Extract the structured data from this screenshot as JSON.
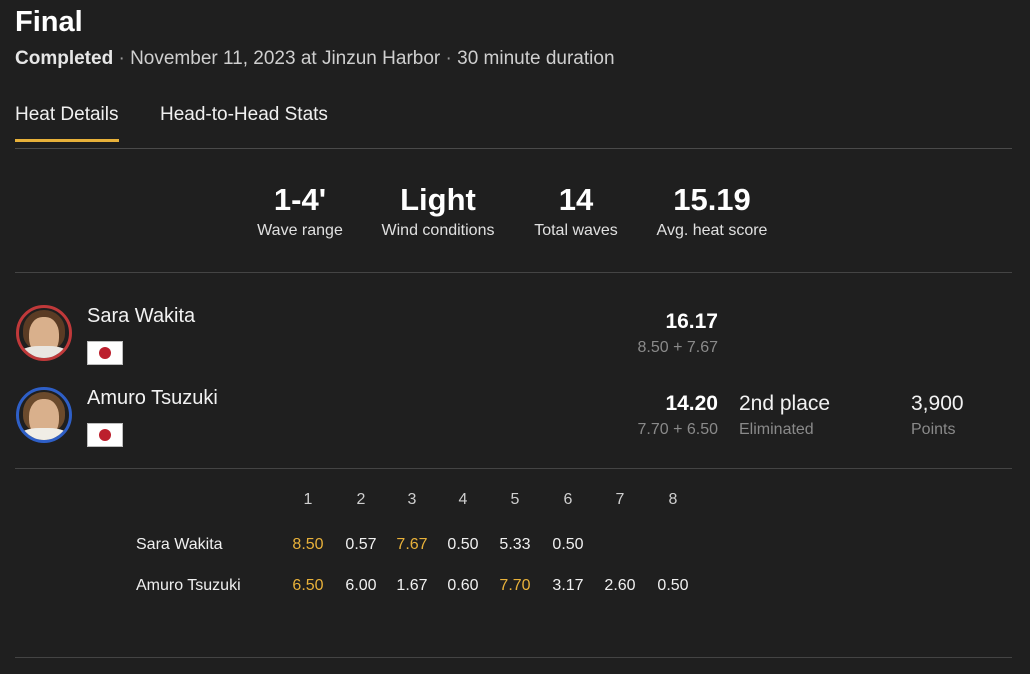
{
  "header": {
    "title": "Final",
    "status": "Completed",
    "date_location": "November 11, 2023 at Jinzun Harbor",
    "duration": "30 minute duration"
  },
  "tabs": [
    {
      "label": "Heat Details",
      "active": true
    },
    {
      "label": "Head-to-Head Stats",
      "active": false
    }
  ],
  "stats": [
    {
      "value": "1-4'",
      "label": "Wave range"
    },
    {
      "value": "Light",
      "label": "Wind conditions"
    },
    {
      "value": "14",
      "label": "Total waves"
    },
    {
      "value": "15.19",
      "label": "Avg. heat score"
    }
  ],
  "athletes": [
    {
      "name": "Sara Wakita",
      "ring_color": "#c0393a",
      "flag": "japan-flag-icon",
      "total": "16.17",
      "breakdown": "8.50 + 7.67"
    },
    {
      "name": "Amuro Tsuzuki",
      "ring_color": "#2e5fc7",
      "flag": "japan-flag-icon",
      "total": "14.20",
      "breakdown": "7.70 + 6.50",
      "place": "2nd place",
      "place_status": "Eliminated",
      "points": "3,900",
      "points_label": "Points"
    }
  ],
  "wave_table": {
    "headers": [
      "1",
      "2",
      "3",
      "4",
      "5",
      "6",
      "7",
      "8"
    ],
    "highlight_color": "#e8b13a",
    "rows": [
      {
        "name": "Sara Wakita",
        "scores": [
          "8.50",
          "0.57",
          "7.67",
          "0.50",
          "5.33",
          "0.50"
        ],
        "counting": [
          0,
          2
        ]
      },
      {
        "name": "Amuro Tsuzuki",
        "scores": [
          "6.50",
          "6.00",
          "1.67",
          "0.60",
          "7.70",
          "3.17",
          "2.60",
          "0.50"
        ],
        "counting": [
          0,
          4
        ]
      }
    ]
  },
  "colors": {
    "accent": "#e8b13a",
    "background": "#1f1f1f"
  }
}
